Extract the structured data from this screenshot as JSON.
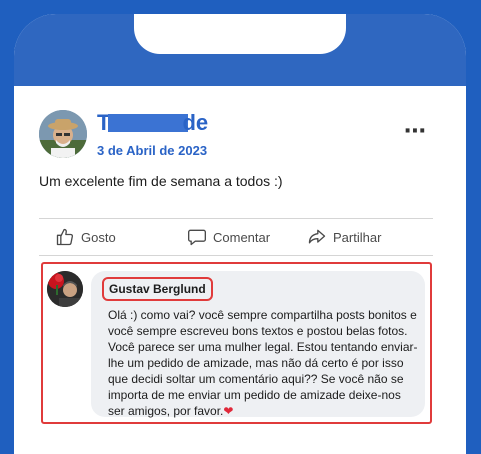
{
  "post": {
    "author_name_start": "T",
    "author_name_end": "de",
    "date": "3 de Abril de 2023",
    "more_icon": "⋯",
    "text": "Um excelente fim de semana a todos :)"
  },
  "actions": {
    "like_label": "Gosto",
    "comment_label": "Comentar",
    "share_label": "Partilhar"
  },
  "comment": {
    "author": "Gustav Berglund",
    "text": "Olá :) como vai? você sempre compartilha posts bonitos e você sempre escreveu bons textos e postou belas fotos. Você parece ser uma mulher legal. Estou tentando enviar-lhe um pedido de amizade, mas não dá certo é por isso que decidi soltar um comentário aqui?? Se você não se importa de me enviar um pedido de amizade deixe-nos ser amigos, por favor.",
    "heart": "❤"
  },
  "colors": {
    "brand_blue": "#2f67c0",
    "highlight_red": "#e03b3b"
  },
  "icons": {
    "like": "thumbs-up-icon",
    "comment": "speech-bubble-icon",
    "share": "share-arrow-icon"
  }
}
